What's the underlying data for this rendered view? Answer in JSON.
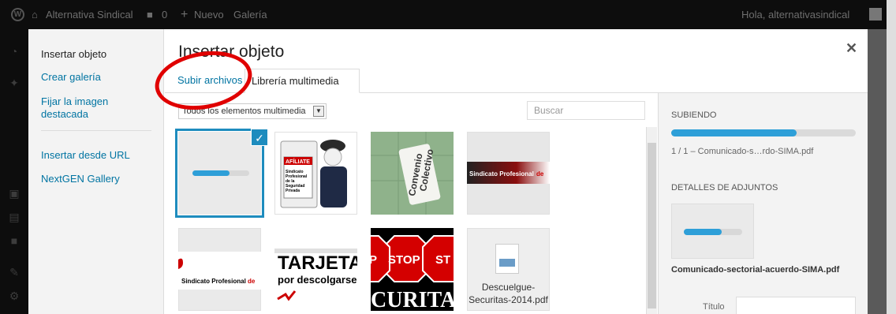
{
  "adminbar": {
    "site_name": "Alternativa Sindical",
    "comments_count": "0",
    "new_label": "Nuevo",
    "gallery_label": "Galería",
    "greeting": "Hola, alternativasindical"
  },
  "modal": {
    "title": "Insertar objeto",
    "close_icon": "close-icon",
    "menu": [
      {
        "label": "Insertar objeto",
        "active": true
      },
      {
        "label": "Crear galería"
      },
      {
        "label": "Fijar la imagen destacada"
      },
      {
        "label": "Insertar desde URL"
      },
      {
        "label": "NextGEN Gallery"
      }
    ],
    "tabs": [
      {
        "label": "Subir archivos"
      },
      {
        "label": "Librería multimedia",
        "active": true
      }
    ],
    "filter": {
      "selected": "Todos los elementos multimedia"
    },
    "search": {
      "placeholder": "Buscar"
    },
    "attachments": [
      {
        "kind": "uploading",
        "progress": 0.65,
        "selected": true
      },
      {
        "kind": "image",
        "caption": "AFÍLIATE Sindicato Profesional de la Seguridad Privada"
      },
      {
        "kind": "image",
        "caption": "Convenio Colectivo"
      },
      {
        "kind": "image",
        "caption": "Sindicato Profesional de"
      },
      {
        "kind": "image",
        "caption": "Sindicato Profesional de"
      },
      {
        "kind": "image",
        "caption": "TARJETA por descolgarse de"
      },
      {
        "kind": "image",
        "caption": "STOP ST CURITA"
      },
      {
        "kind": "file",
        "filename": "Descuelgue-Securitas-2014.pdf"
      }
    ]
  },
  "sidebar": {
    "uploading_heading": "SUBIENDO",
    "upload_progress": 0.68,
    "upload_file": "1 / 1  –  Comunicado-s…rdo-SIMA.pdf",
    "details_heading": "DETALLES DE ADJUNTOS",
    "thumb_progress": 0.65,
    "attachment_name": "Comunicado-sectorial-acuerdo-SIMA.pdf",
    "title_label": "Título"
  },
  "colors": {
    "accent": "#2e9fd8",
    "link": "#0074a2",
    "annotation": "#e00000"
  }
}
